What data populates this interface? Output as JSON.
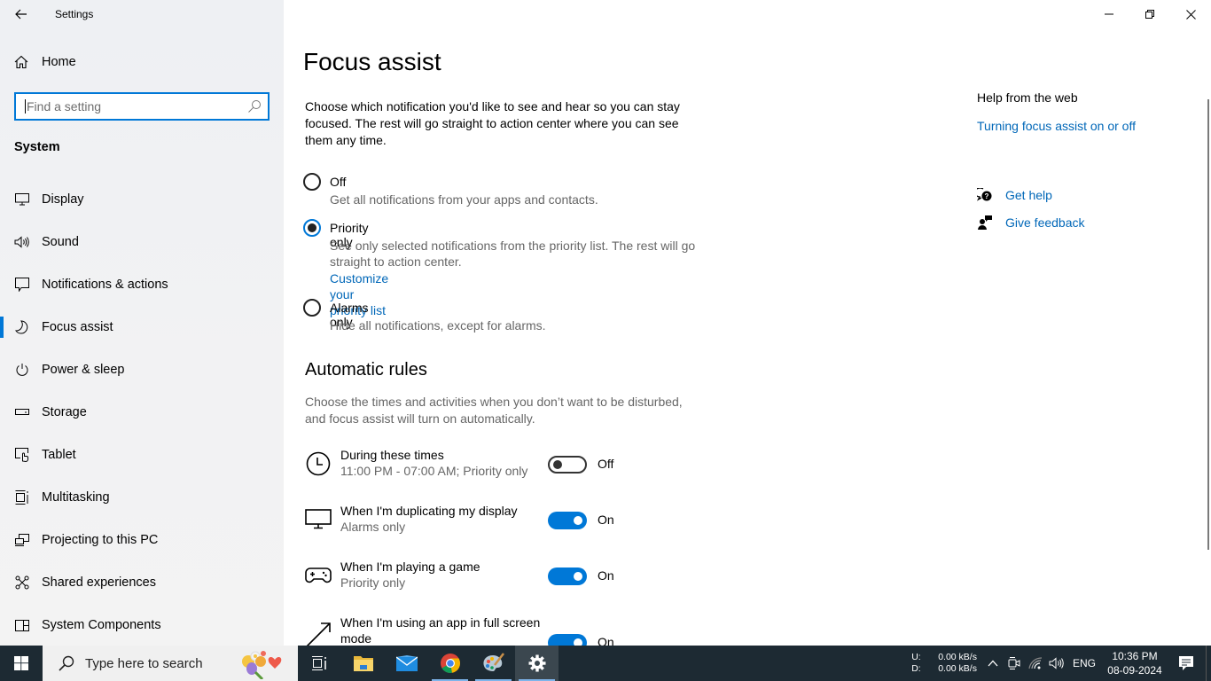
{
  "window": {
    "title": "Settings",
    "controls": {
      "minimize": "minimize",
      "restore": "restore",
      "close": "close"
    }
  },
  "sidebar": {
    "home_label": "Home",
    "search_placeholder": "Find a setting",
    "search_value": "",
    "section": "System",
    "items": [
      {
        "label": "Display",
        "icon": "monitor-icon",
        "active": false
      },
      {
        "label": "Sound",
        "icon": "speaker-icon",
        "active": false
      },
      {
        "label": "Notifications & actions",
        "icon": "notification-icon",
        "active": false
      },
      {
        "label": "Focus assist",
        "icon": "moon-icon",
        "active": true
      },
      {
        "label": "Power & sleep",
        "icon": "power-icon",
        "active": false
      },
      {
        "label": "Storage",
        "icon": "storage-icon",
        "active": false
      },
      {
        "label": "Tablet",
        "icon": "tablet-icon",
        "active": false
      },
      {
        "label": "Multitasking",
        "icon": "multitasking-icon",
        "active": false
      },
      {
        "label": "Projecting to this PC",
        "icon": "projecting-icon",
        "active": false
      },
      {
        "label": "Shared experiences",
        "icon": "shared-icon",
        "active": false
      },
      {
        "label": "System Components",
        "icon": "components-icon",
        "active": false
      }
    ]
  },
  "main": {
    "title": "Focus assist",
    "intro": "Choose which notification you'd like to see and hear so you can stay focused. The rest will go straight to action center where you can see them any time.",
    "options": [
      {
        "label": "Off",
        "desc": "Get all notifications from your apps and contacts.",
        "selected": false
      },
      {
        "label": "Priority only",
        "desc": "See only selected notifications from the priority list. The rest will go straight to action center.",
        "link": "Customize your priority list",
        "selected": true
      },
      {
        "label": "Alarms only",
        "desc": "Hide all notifications, except for alarms.",
        "selected": false
      }
    ],
    "rules_title": "Automatic rules",
    "rules_desc": "Choose the times and activities when you don’t want to be disturbed, and focus assist will turn on automatically.",
    "rules": [
      {
        "title": "During these times",
        "sub": "11:00 PM - 07:00 AM; Priority only",
        "state": "Off",
        "on": false,
        "icon": "clock-icon"
      },
      {
        "title": "When I'm duplicating my display",
        "sub": "Alarms only",
        "state": "On",
        "on": true,
        "icon": "monitor-icon"
      },
      {
        "title": "When I'm playing a game",
        "sub": "Priority only",
        "state": "On",
        "on": true,
        "icon": "gamepad-icon"
      },
      {
        "title": "When I'm using an app in full screen mode",
        "sub": "",
        "state": "On",
        "on": true,
        "icon": "fullscreen-icon"
      }
    ]
  },
  "help": {
    "title": "Help from the web",
    "link": "Turning focus assist on or off",
    "get_help": "Get help",
    "give_feedback": "Give feedback"
  },
  "taskbar": {
    "search_placeholder": "Type here to search",
    "apps": [
      {
        "name": "task-view",
        "running": false,
        "active": false
      },
      {
        "name": "file-explorer",
        "running": false,
        "active": false
      },
      {
        "name": "mail",
        "running": false,
        "active": false
      },
      {
        "name": "chrome",
        "running": true,
        "active": false
      },
      {
        "name": "paint",
        "running": true,
        "active": false
      },
      {
        "name": "settings",
        "running": true,
        "active": true
      }
    ],
    "net_upload_label": "U:",
    "net_download_label": "D:",
    "net_upload": "0.00 kB/s",
    "net_download": "0.00 kB/s",
    "language": "ENG",
    "time": "10:36 PM",
    "date": "08-09-2024"
  },
  "colors": {
    "accent": "#0078d7",
    "link": "#0067b8",
    "taskbar": "#1d2a33"
  }
}
